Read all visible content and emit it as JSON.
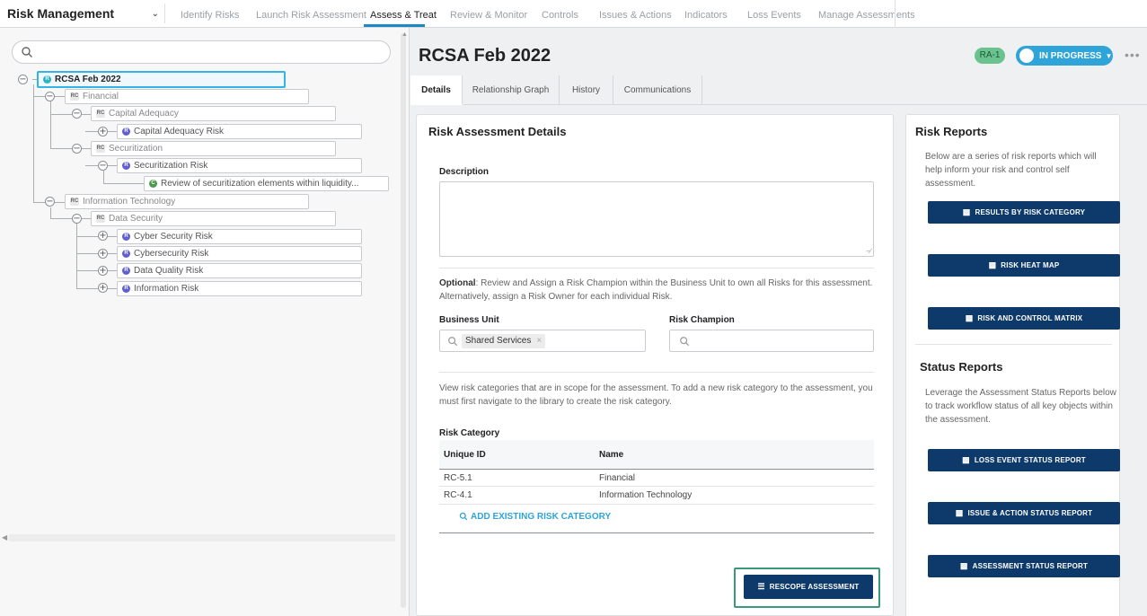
{
  "topnav": {
    "app_name": "Risk Management",
    "items": [
      "Identify Risks",
      "Launch Risk Assessment",
      "Assess & Treat",
      "Review & Monitor",
      "Controls",
      "Issues & Actions",
      "Indicators",
      "Loss Events",
      "Manage Assessments"
    ],
    "active_index": 2
  },
  "tree": {
    "search_placeholder": "",
    "nodes": [
      {
        "label": "RCSA Feb 2022",
        "type": "RA"
      },
      {
        "label": "Financial",
        "type": "RC"
      },
      {
        "label": "Capital Adequacy",
        "type": "RC"
      },
      {
        "label": "Capital Adequacy Risk",
        "type": "R"
      },
      {
        "label": "Securitization",
        "type": "RC"
      },
      {
        "label": "Securitization Risk",
        "type": "R"
      },
      {
        "label": "Review of securitization elements within liquidity...",
        "type": "C"
      },
      {
        "label": "Information Technology",
        "type": "RC"
      },
      {
        "label": "Data Security",
        "type": "RC"
      },
      {
        "label": "Cyber Security Risk",
        "type": "R"
      },
      {
        "label": "Cybersecurity Risk",
        "type": "R"
      },
      {
        "label": "Data Quality Risk",
        "type": "R"
      },
      {
        "label": "Information Risk",
        "type": "R"
      }
    ]
  },
  "header": {
    "title": "RCSA Feb 2022",
    "id_badge": "RA-1",
    "status": "IN PROGRESS",
    "more": "•••"
  },
  "tabs": [
    "Details",
    "Relationship Graph",
    "History",
    "Communications"
  ],
  "details": {
    "title": "Risk Assessment Details",
    "description_label": "Description",
    "description_value": "",
    "optional_bold": "Optional",
    "optional_text": ": Review and Assign a Risk Champion within the Business Unit to own all Risks for this assessment. Alternatively, assign a Risk Owner for each individual Risk.",
    "business_unit_label": "Business Unit",
    "business_unit_value": "Shared Services",
    "risk_champion_label": "Risk Champion",
    "scope_text": "View risk categories that are in scope for the assessment. To add a new risk category to the assessment, you must first navigate to the library to create the risk category.",
    "risk_category_label": "Risk Category",
    "table": {
      "headers": [
        "Unique ID",
        "Name"
      ],
      "rows": [
        [
          "RC-5.1",
          "Financial"
        ],
        [
          "RC-4.1",
          "Information Technology"
        ]
      ]
    },
    "add_link": "ADD EXISTING RISK CATEGORY",
    "rescope_button": "RESCOPE ASSESSMENT"
  },
  "reports": {
    "risk_title": "Risk Reports",
    "risk_text": "Below are a series of risk reports which will help inform your risk and control self assessment.",
    "risk_buttons": [
      "RESULTS BY RISK CATEGORY",
      "RISK HEAT MAP",
      "RISK AND CONTROL MATRIX"
    ],
    "status_title": "Status Reports",
    "status_text": "Leverage the Assessment Status Reports below to track workflow status of all key objects within the assessment.",
    "status_buttons": [
      "LOSS EVENT STATUS REPORT",
      "ISSUE & ACTION STATUS REPORT",
      "ASSESSMENT STATUS REPORT"
    ]
  },
  "colors": {
    "accent": "#2ea4d9",
    "button": "#0e3a6b",
    "badge": "#6ac38f",
    "focus": "#3a9a78"
  }
}
